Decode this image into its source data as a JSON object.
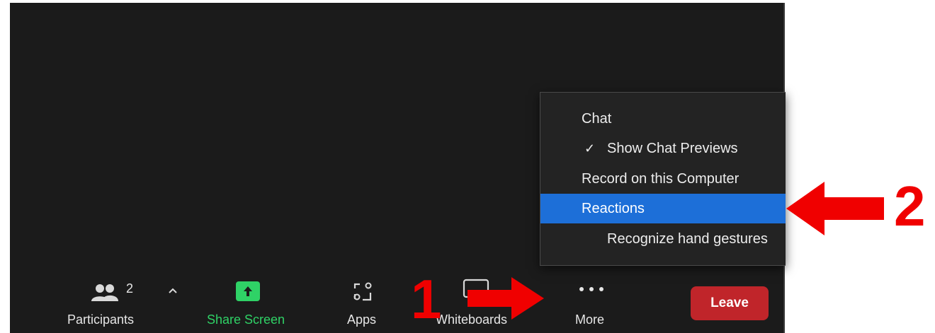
{
  "toolbar": {
    "participants": {
      "label": "Participants",
      "count": "2"
    },
    "share_screen": {
      "label": "Share Screen"
    },
    "apps": {
      "label": "Apps"
    },
    "whiteboards": {
      "label": "Whiteboards"
    },
    "more": {
      "label": "More"
    },
    "leave": {
      "label": "Leave"
    }
  },
  "more_menu": {
    "items": [
      {
        "label": "Chat"
      },
      {
        "label": "Show Chat Previews",
        "checked": true
      },
      {
        "label": "Record on this Computer"
      },
      {
        "label": "Reactions",
        "selected": true
      },
      {
        "label": "Recognize hand gestures"
      }
    ]
  },
  "annotations": {
    "step1": "1",
    "step2": "2",
    "color": "#f00000"
  },
  "colors": {
    "background": "#1b1b1b",
    "menu_highlight": "#1d6fd8",
    "share_green": "#2fd266",
    "leave_red": "#c0252a"
  }
}
